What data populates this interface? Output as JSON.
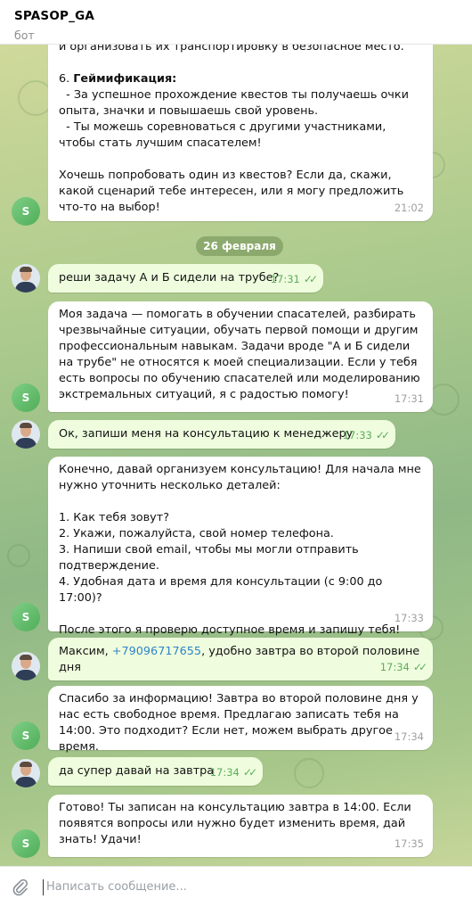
{
  "header": {
    "title": "SPASOP_GA",
    "subtitle": "бот"
  },
  "date_divider": "26 февраля",
  "messages": [
    {
      "text_a": "и организовать их транспортировку в безопасное место.\n\n6. ",
      "bold": "Геймификация:",
      "text_b": "\n  - За успешное прохождение квестов ты получаешь очки опыта, значки и повышаешь свой уровень.\n  - Ты можешь соревноваться с другими участниками, чтобы стать лучшим спасателем!\n\nХочешь попробовать один из квестов? Если да, скажи, какой сценарий тебе интересен, или я могу предложить что-то на выбор!",
      "time": "21:02"
    },
    {
      "text": "реши задачу А и Б сидели на трубе?",
      "time": "17:31"
    },
    {
      "text": "Моя задача — помогать в обучении спасателей, разбирать чрезвычайные ситуации, обучать первой помощи и другим профессиональным навыкам. Задачи вроде \"А и Б сидели на трубе\" не относятся к моей специализации. Если у тебя есть вопросы по обучению спасателей или моделированию экстремальных ситуаций, я с радостью помогу!",
      "time": "17:31"
    },
    {
      "text": "Ок, запиши меня на консультацию к менеджеру",
      "time": "17:33"
    },
    {
      "text": "Конечно, давай организуем консультацию! Для начала мне нужно уточнить несколько деталей:\n\n1. Как тебя зовут?\n2. Укажи, пожалуйста, свой номер телефона.\n3. Напиши свой email, чтобы мы могли отправить подтверждение.\n4. Удобная дата и время для консультации (с 9:00 до 17:00)?\n\nПосле этого я проверю доступное время и запишу тебя!",
      "time": "17:33"
    },
    {
      "text_a": "Максим, ",
      "phone": "+79096717655",
      "text_b": ", удобно завтра во второй половине дня",
      "time": "17:34"
    },
    {
      "text": "Спасибо за информацию! Завтра во второй половине дня у нас есть свободное время. Предлагаю записать тебя на 14:00. Это подходит? Если нет, можем выбрать другое время.",
      "time": "17:34"
    },
    {
      "text": "да супер давай на завтра",
      "time": "17:34"
    },
    {
      "text": "Готово! Ты записан на консультацию завтра в 14:00. Если появятся вопросы или нужно будет изменить время, дай знать! Удачи!",
      "time": "17:35"
    }
  ],
  "bot_avatar_letter": "S",
  "read_mark": "✓✓",
  "composer": {
    "placeholder": "Написать сообщение..."
  },
  "colors": {
    "accent": "#5dad5d",
    "link": "#2f84c8",
    "user_bubble": "#effdde"
  }
}
